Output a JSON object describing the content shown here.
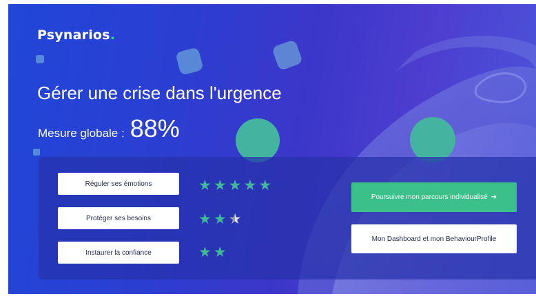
{
  "brand": {
    "name": "Psynarios",
    "dot": ".",
    "dot_color": "#34d399"
  },
  "hero": {
    "title": "Gérer une crise dans l'urgence",
    "score_label": "Mesure globale :",
    "score_value": "88%"
  },
  "skills": [
    {
      "label": "Réguler ses émotions",
      "stars": 5
    },
    {
      "label": "Protéger ses besoins",
      "stars": 2.5
    },
    {
      "label": "Instaurer la confiance",
      "stars": 2
    }
  ],
  "actions": {
    "primary_label": "Poursuivre mon parcours individualisé",
    "primary_icon": "arrow-right-icon",
    "primary_arrow": "➜",
    "secondary_label": "Mon Dashboard et mon BehaviourProfile"
  },
  "colors": {
    "background_start": "#2146d8",
    "background_end": "#4a56dc",
    "accent_green": "#3bc08a",
    "star_color": "#43b79b"
  },
  "glyphs": {
    "star": "★"
  }
}
